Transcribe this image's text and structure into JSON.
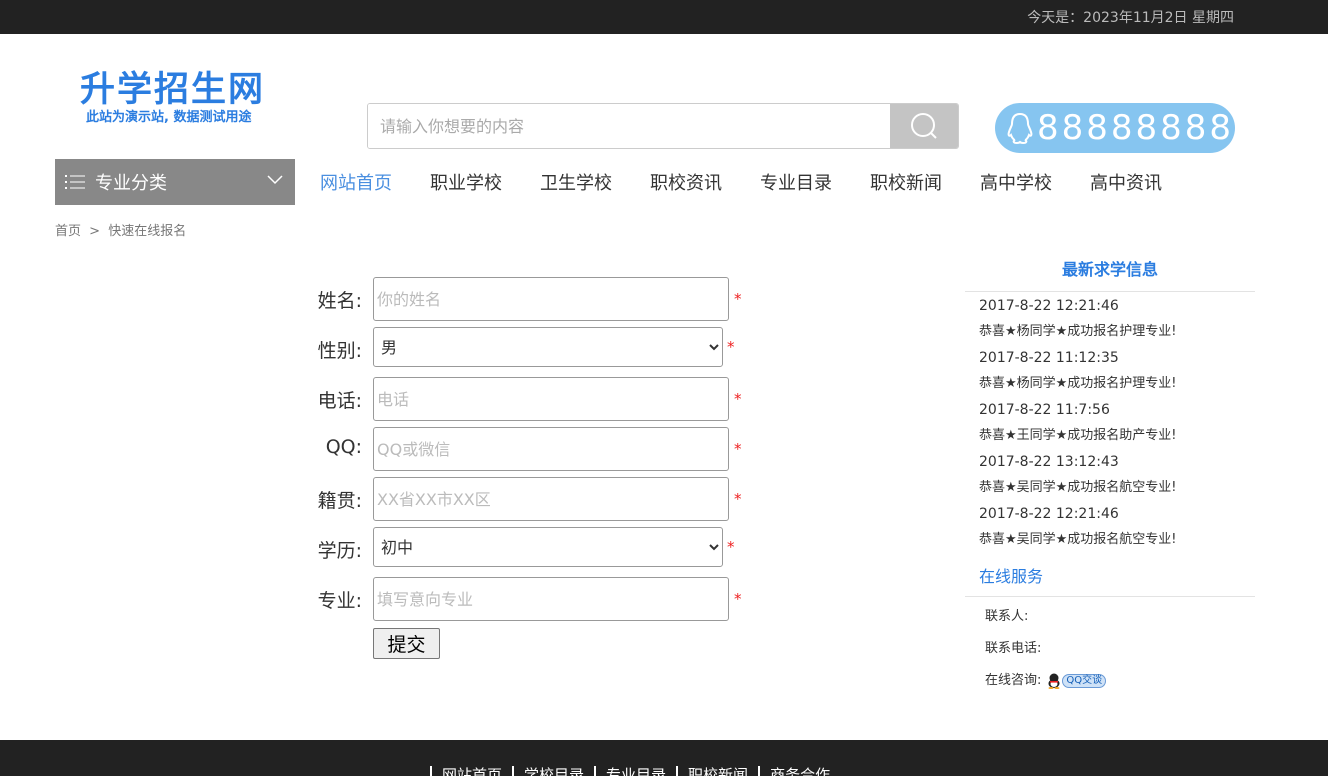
{
  "topbar": {
    "date_text": "今天是：2023年11月2日 星期四"
  },
  "logo": {
    "title": "升学招生网",
    "subtitle": "此站为演示站, 数据测试用途"
  },
  "search": {
    "placeholder": "请输入你想要的内容",
    "icon": "search-icon"
  },
  "qq_phone": {
    "icon": "qq-penguin-icon",
    "number": "88888888",
    "color": "#86c5f0"
  },
  "nav": {
    "category_label": "专业分类",
    "items": [
      "网站首页",
      "职业学校",
      "卫生学校",
      "职校资讯",
      "专业目录",
      "职校新闻",
      "高中学校",
      "高中资讯"
    ],
    "active_index": 0
  },
  "breadcrumb": {
    "home": "首页",
    "sep": ">",
    "current": "快速在线报名"
  },
  "form": {
    "name_label": "姓名:",
    "name_placeholder": "你的姓名",
    "gender_label": "性别:",
    "gender_value": "男",
    "phone_label": "电话:",
    "phone_placeholder": "电话",
    "qq_label": "QQ:",
    "qq_placeholder": "QQ或微信",
    "origin_label": "籍贯:",
    "origin_placeholder": "XX省XX市XX区",
    "edu_label": "学历:",
    "edu_value": "初中",
    "major_label": "专业:",
    "major_placeholder": "填写意向专业",
    "required_mark": "*",
    "submit_label": "提交"
  },
  "sidebar": {
    "latest_title": "最新求学信息",
    "latest": [
      {
        "time": "2017-8-22 12:21:46",
        "msg": "恭喜★杨同学★成功报名护理专业!"
      },
      {
        "time": "2017-8-22 11:12:35",
        "msg": "恭喜★杨同学★成功报名护理专业!"
      },
      {
        "time": "2017-8-22 11:7:56",
        "msg": "恭喜★王同学★成功报名助产专业!"
      },
      {
        "time": "2017-8-22 13:12:43",
        "msg": "恭喜★吴同学★成功报名航空专业!"
      },
      {
        "time": "2017-8-22 12:21:46",
        "msg": "恭喜★吴同学★成功报名航空专业!"
      }
    ],
    "service_title": "在线服务",
    "contact_label": "联系人:",
    "contact_phone_label": "联系电话:",
    "consult_label": "在线咨询:",
    "qq_chat_label": "QQ交谈"
  },
  "footer": {
    "links": [
      "网站首页",
      "学校目录",
      "专业目录",
      "职校新闻",
      "商务合作"
    ]
  }
}
